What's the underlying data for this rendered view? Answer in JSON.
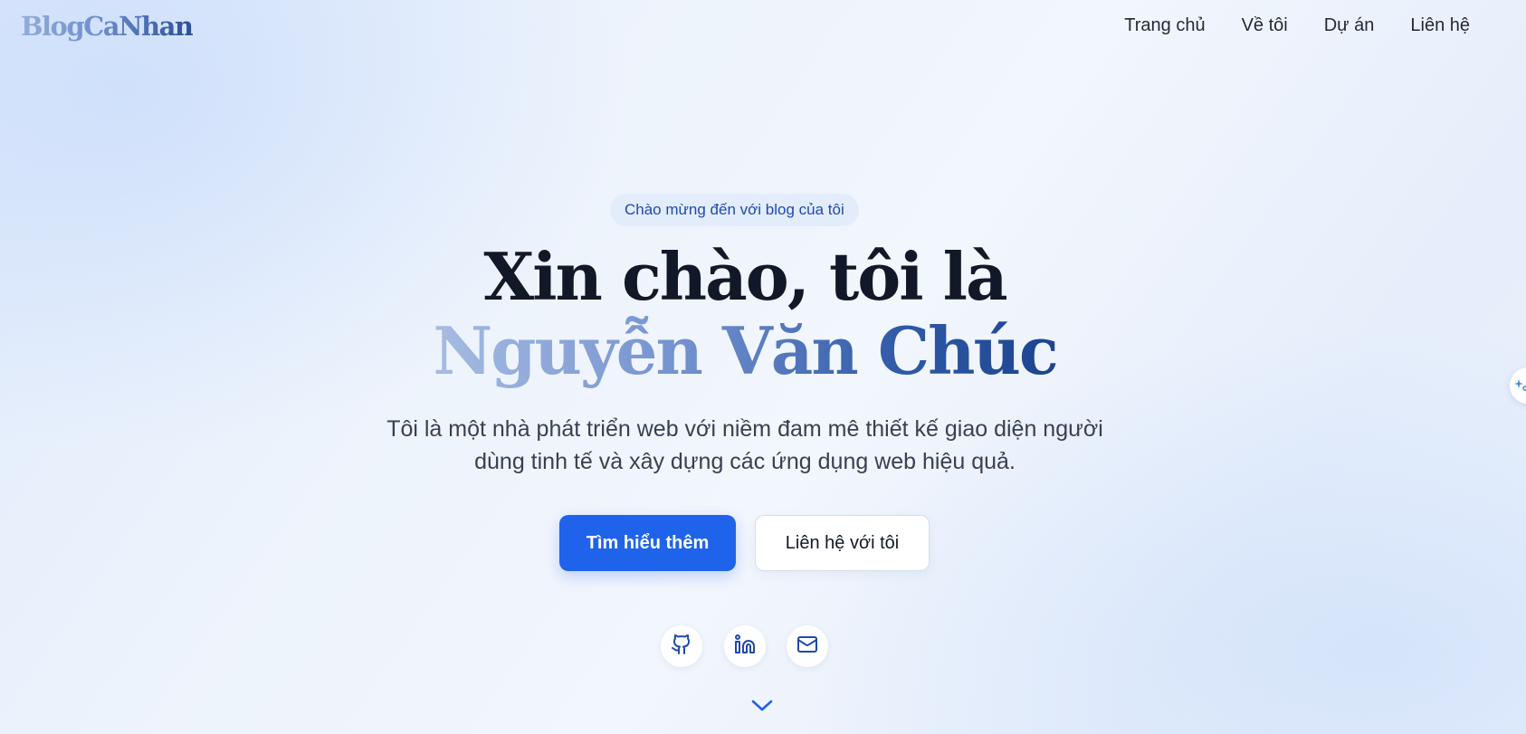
{
  "header": {
    "logo": "BlogCaNhan",
    "nav": [
      "Trang chủ",
      "Về tôi",
      "Dự án",
      "Liên hệ"
    ]
  },
  "hero": {
    "badge": "Chào mừng đến với blog của tôi",
    "headline_line1": "Xin chào, tôi là",
    "headline_name": "Nguyễn Văn Chúc",
    "subtitle_line1": "Tôi là một nhà phát triển web với niềm đam mê thiết kế giao diện người",
    "subtitle_line2": "dùng tinh tế và xây dựng các ứng dụng web hiệu quả.",
    "primary_button": "Tìm hiểu thêm",
    "secondary_button": "Liên hệ với tôi"
  },
  "social_links": [
    {
      "icon": "github-icon"
    },
    {
      "icon": "linkedin-icon"
    },
    {
      "icon": "mail-icon"
    }
  ],
  "colors": {
    "accent": "#1f63ea",
    "icon_blue": "#1e4aa8",
    "heading": "#111827"
  }
}
